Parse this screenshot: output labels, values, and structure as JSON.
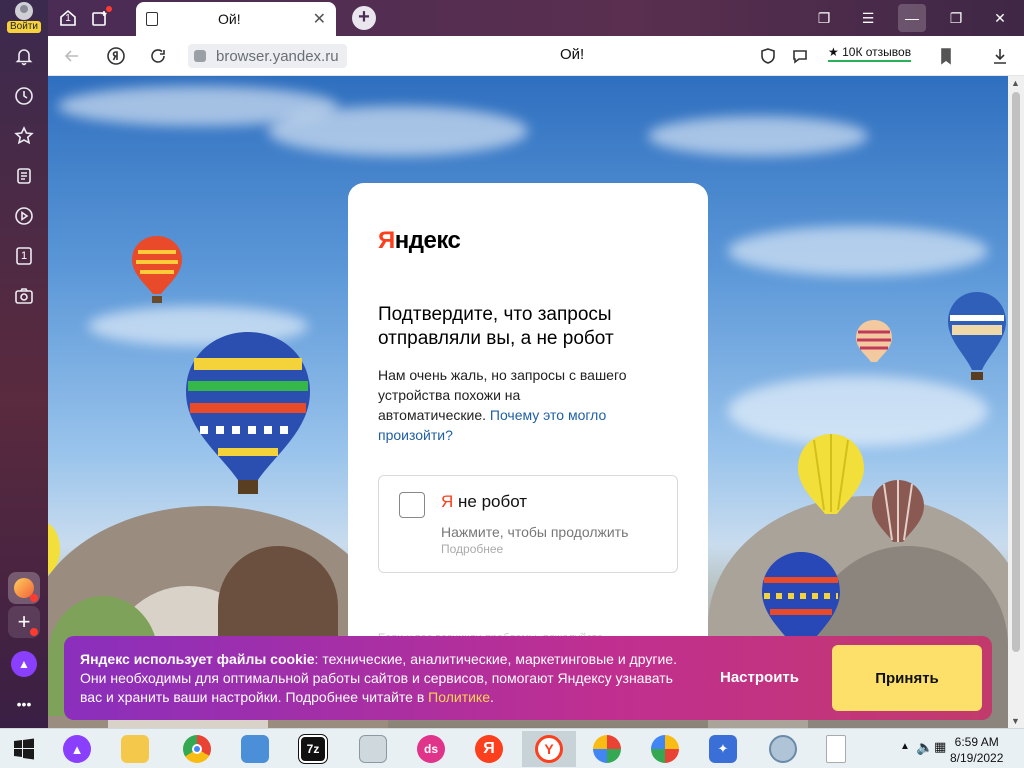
{
  "sidebar": {
    "login_label": "Войти",
    "items": [
      {
        "icon": "bell-icon"
      },
      {
        "icon": "history-icon"
      },
      {
        "icon": "star-icon"
      },
      {
        "icon": "collections-icon"
      },
      {
        "icon": "play-icon"
      },
      {
        "icon": "counter-icon",
        "badge": "1"
      },
      {
        "icon": "screenshot-icon"
      }
    ],
    "bottom_apps": [
      {
        "icon": "mail-icon",
        "color": "#f2a33a"
      },
      {
        "icon": "add-icon"
      },
      {
        "icon": "alice-icon",
        "color": "#8a3ffc"
      },
      {
        "icon": "more-icon",
        "label": "•••"
      }
    ]
  },
  "tabs": {
    "counter": "1",
    "active_tab_title": "Ой!",
    "new_tab_label": "+"
  },
  "window_controls": {
    "collections": "collections-icon",
    "menu": "menu-icon",
    "minimize": "minimize-icon",
    "restore": "restore-icon",
    "close": "close-icon"
  },
  "addressbar": {
    "url": "browser.yandex.ru",
    "page_title": "Ой!",
    "reviews": "★ 10К отзывов"
  },
  "captcha": {
    "logo_prefix": "Я",
    "logo_rest": "ндекс",
    "heading": "Подтвердите, что запросы отправляли вы, а не робот",
    "desc_text": "Нам очень жаль, но запросы с вашего устройства похожи на автоматические. ",
    "desc_link": "Почему это могло произойти?",
    "checkbox_label_prefix": "Я",
    "checkbox_label_rest": " не робот",
    "hint": "Нажмите, чтобы продолжить",
    "more": "Подробнее",
    "cutoff_text": "Если у вас возникли проблемы, пожалуйста"
  },
  "cookie": {
    "bold": "Яндекс использует файлы cookie",
    "text": ": технические, аналитические, маркетинговые и другие. Они необходимы для оптимальной работы сайтов и сервисов, помогают Яндексу узнавать вас и хранить ваши настройки. Подробнее читайте в ",
    "link": "Политике",
    "end": ".",
    "configure": "Настроить",
    "accept": "Принять"
  },
  "taskbar": {
    "items": [
      "windows-start-icon",
      "alice-icon",
      "file-explorer-icon",
      "chrome-icon",
      "control-panel-icon",
      "7zip-icon",
      "monitor-icon",
      "ds-icon",
      "yandex-icon",
      "yandex-browser-icon",
      "ball-icon",
      "ball-icon",
      "magic-wand-icon",
      "disc-icon",
      "document-icon"
    ],
    "clock_time": "6:59 AM",
    "clock_date": "8/19/2022"
  },
  "colors": {
    "yandex_red": "#fc3f1d",
    "link_blue": "#1f5fa6",
    "accept_yellow": "#fde069",
    "cookie_gradient_start": "#8a2fbd",
    "cookie_gradient_end": "#c23a6c"
  }
}
